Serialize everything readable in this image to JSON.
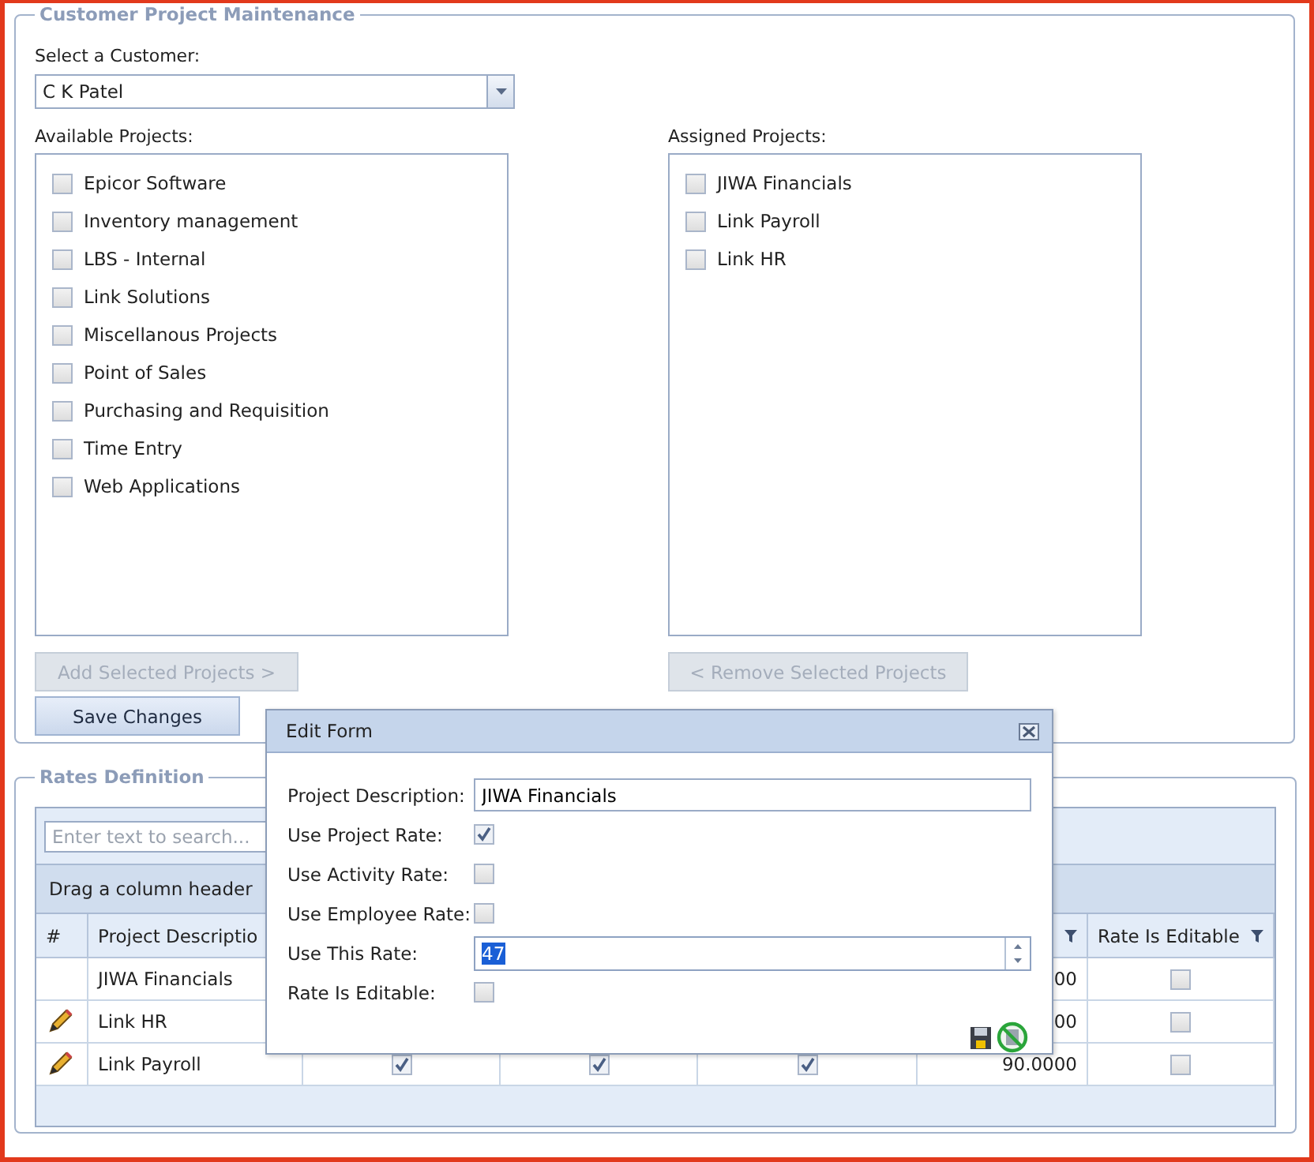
{
  "customer_project_maintenance": {
    "title": "Customer Project Maintenance",
    "customer": {
      "label": "Select a Customer:",
      "value": "C K Patel"
    },
    "available": {
      "label": "Available Projects:",
      "items": [
        {
          "label": "Epicor Software",
          "checked": false
        },
        {
          "label": "Inventory management",
          "checked": false
        },
        {
          "label": "LBS - Internal",
          "checked": false
        },
        {
          "label": "Link Solutions",
          "checked": false
        },
        {
          "label": "Miscellanous Projects",
          "checked": false
        },
        {
          "label": "Point of Sales",
          "checked": false
        },
        {
          "label": "Purchasing and Requisition",
          "checked": false
        },
        {
          "label": "Time Entry",
          "checked": false
        },
        {
          "label": "Web Applications",
          "checked": false
        }
      ]
    },
    "assigned": {
      "label": "Assigned Projects:",
      "items": [
        {
          "label": "JIWA Financials",
          "checked": false
        },
        {
          "label": "Link Payroll",
          "checked": false
        },
        {
          "label": "Link HR",
          "checked": false
        }
      ]
    },
    "add_button": {
      "label": "Add Selected Projects >",
      "disabled": true
    },
    "remove_button": {
      "label": "< Remove Selected Projects",
      "disabled": true
    },
    "save_button": {
      "label": "Save Changes",
      "disabled": false
    }
  },
  "rates_definition": {
    "title": "Rates Definition",
    "search": {
      "placeholder": "Enter text to search..."
    },
    "group_hint": "Drag a column header",
    "columns": [
      {
        "label": "#"
      },
      {
        "label": "Project Descriptio"
      },
      {},
      {},
      {},
      {
        "filter": true
      },
      {
        "label": "Rate Is Editable",
        "filter": true
      }
    ],
    "rows": [
      {
        "edit_icon": false,
        "project": "JIWA Financials",
        "rate": "00",
        "rate_is_editable": false
      },
      {
        "edit_icon": true,
        "project": "Link HR",
        "rate": "00",
        "rate_is_editable": false
      },
      {
        "edit_icon": true,
        "project": "Link Payroll",
        "flags": [
          true,
          true,
          true
        ],
        "rate": "90.0000",
        "rate_is_editable": false
      }
    ]
  },
  "edit_form": {
    "title": "Edit Form",
    "fields": [
      {
        "kind": "text",
        "label": "Project Description:",
        "value": "JIWA Financials"
      },
      {
        "kind": "checkbox",
        "label": "Use Project Rate:",
        "checked": true
      },
      {
        "kind": "checkbox",
        "label": "Use Activity Rate:",
        "checked": false
      },
      {
        "kind": "checkbox",
        "label": "Use Employee Rate:",
        "checked": false
      },
      {
        "kind": "spin",
        "label": "Use This Rate:",
        "value": "47",
        "value_selected": true
      },
      {
        "kind": "checkbox",
        "label": "Rate Is Editable:",
        "checked": false
      }
    ]
  }
}
